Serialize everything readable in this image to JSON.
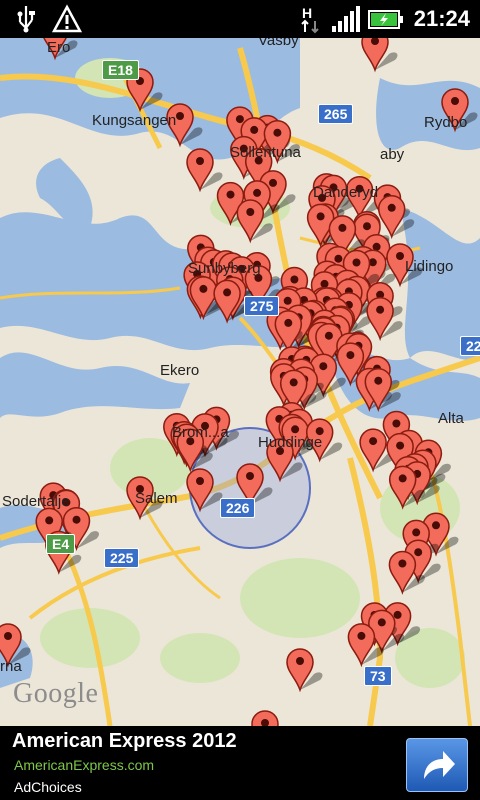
{
  "status_bar": {
    "time": "21:24",
    "icons": [
      "usb-icon",
      "warning-icon",
      "hsdpa-icon",
      "signal-icon",
      "battery-icon"
    ],
    "network_label": "H"
  },
  "map": {
    "places": [
      "Ekero",
      "Kungsangen",
      "Sollentuna",
      "Danderyd",
      "Sundbyberg",
      "Lidingo",
      "Bromma",
      "Huddinge",
      "Salem",
      "Sodertalje",
      "Alta",
      "Rydbo",
      "Taby",
      "Vasby",
      "Ero",
      "rna"
    ],
    "place_texts": {
      "ekero": "Ekero",
      "kungsangen": "Kungsangen",
      "sollentuna": "Sollentuna",
      "danderyd": "Danderyd",
      "sundbyberg": "Sunbyberg",
      "lidingo": "Lidingo",
      "bromma": "Brom...a",
      "huddinge": "Huddinge",
      "salem": "Salem",
      "sodertalje": "Sodertalje",
      "alta": "Alta",
      "rydbo": "Rydbo",
      "taby": "aby",
      "vasby": "Vasby",
      "ero": "Ero",
      "rna": "rna"
    },
    "road_labels": {
      "e18": "E18",
      "r265": "265",
      "r275": "275",
      "r226": "226",
      "r225": "225",
      "r73": "73",
      "r22": "22",
      "e4": "E4"
    },
    "attribution": "Google",
    "colors": {
      "water": "#9cbbe0",
      "land": "#ece6d8",
      "park": "#d3e5b5",
      "road": "#f7c94d",
      "pin": "#f26b5b",
      "location_circle": "#8a9ee6"
    },
    "marker_count": 150
  },
  "ad": {
    "title": "American Express 2012",
    "url": "AmericanExpress.com",
    "choices": "AdChoices",
    "button_icon": "share-arrow-icon"
  }
}
